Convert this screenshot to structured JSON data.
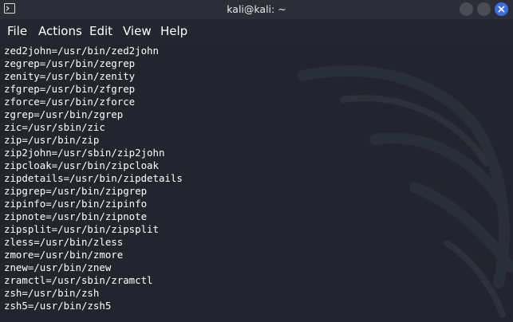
{
  "window": {
    "title": "kali@kali: ~",
    "icon": "terminal-icon"
  },
  "menu": [
    "File",
    "Actions",
    "Edit",
    "View",
    "Help"
  ],
  "terminal": {
    "lines": [
      "zed2john=/usr/bin/zed2john",
      "zegrep=/usr/bin/zegrep",
      "zenity=/usr/bin/zenity",
      "zfgrep=/usr/bin/zfgrep",
      "zforce=/usr/bin/zforce",
      "zgrep=/usr/bin/zgrep",
      "zic=/usr/sbin/zic",
      "zip=/usr/bin/zip",
      "zip2john=/usr/sbin/zip2john",
      "zipcloak=/usr/bin/zipcloak",
      "zipdetails=/usr/bin/zipdetails",
      "zipgrep=/usr/bin/zipgrep",
      "zipinfo=/usr/bin/zipinfo",
      "zipnote=/usr/bin/zipnote",
      "zipsplit=/usr/bin/zipsplit",
      "zless=/usr/bin/zless",
      "zmore=/usr/bin/zmore",
      "znew=/usr/bin/znew",
      "zramctl=/usr/sbin/zramctl",
      "zsh=/usr/bin/zsh",
      "zsh5=/usr/bin/zsh5"
    ]
  },
  "colors": {
    "close_button": "#3b6fe0",
    "text": "#ffffff",
    "background": "#22252d"
  }
}
